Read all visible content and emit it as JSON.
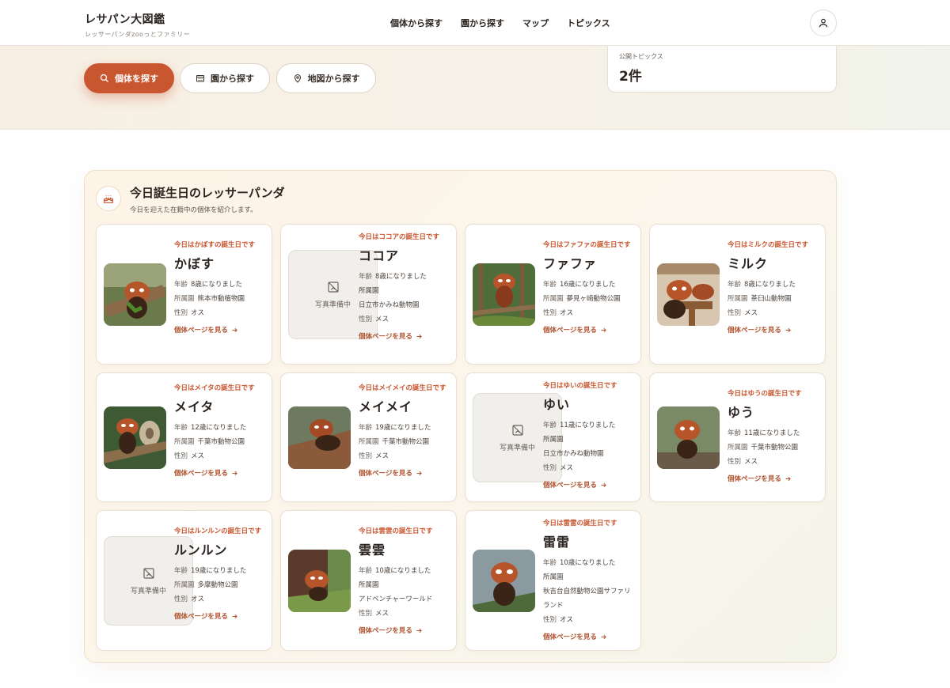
{
  "brand": {
    "title": "レサパン大図鑑",
    "subtitle": "レッサーパンダzooっとファミリー"
  },
  "nav": [
    "個体から探す",
    "園から探す",
    "マップ",
    "トピックス"
  ],
  "hero": {
    "buttons": [
      "個体を探す",
      "園から探す",
      "地図から探す"
    ],
    "stat_label": "公開トピックス",
    "stat_value": "2件"
  },
  "section": {
    "title": "今日誕生日のレッサーパンダ",
    "subtitle": "今日を迎えた在籍中の個体を紹介します。"
  },
  "labels": {
    "age": "年齢",
    "zoo": "所属園",
    "sex": "性別",
    "link": "個体ページを見る",
    "placeholder": "写真準備中"
  },
  "cards": [
    {
      "bday": "今日はかぼすの誕生日です",
      "name": "かぼす",
      "age": "8歳になりました",
      "zoo": "熊本市動植物園",
      "sex": "オス",
      "photo": true
    },
    {
      "bday": "今日はココアの誕生日です",
      "name": "ココア",
      "age": "8歳になりました",
      "zoo": "日立市かみね動物園",
      "sex": "メス",
      "photo": false
    },
    {
      "bday": "今日はファファの誕生日です",
      "name": "ファファ",
      "age": "16歳になりました",
      "zoo": "夢見ヶ崎動物公園",
      "sex": "オス",
      "photo": true
    },
    {
      "bday": "今日はミルクの誕生日です",
      "name": "ミルク",
      "age": "8歳になりました",
      "zoo": "茶臼山動物園",
      "sex": "メス",
      "photo": true
    },
    {
      "bday": "今日はメイタの誕生日です",
      "name": "メイタ",
      "age": "12歳になりました",
      "zoo": "千葉市動物公園",
      "sex": "メス",
      "photo": true
    },
    {
      "bday": "今日はメイメイの誕生日です",
      "name": "メイメイ",
      "age": "19歳になりました",
      "zoo": "千葉市動物公園",
      "sex": "メス",
      "photo": true
    },
    {
      "bday": "今日はゆいの誕生日です",
      "name": "ゆい",
      "age": "11歳になりました",
      "zoo": "日立市かみね動物園",
      "sex": "メス",
      "photo": false
    },
    {
      "bday": "今日はゆうの誕生日です",
      "name": "ゆう",
      "age": "11歳になりました",
      "zoo": "千葉市動物公園",
      "sex": "メス",
      "photo": true
    },
    {
      "bday": "今日はルンルンの誕生日です",
      "name": "ルンルン",
      "age": "19歳になりました",
      "zoo": "多摩動物公園",
      "sex": "オス",
      "photo": false
    },
    {
      "bday": "今日は雲雲の誕生日です",
      "name": "雲雲",
      "age": "10歳になりました",
      "zoo": "アドベンチャーワールド",
      "sex": "メス",
      "photo": true
    },
    {
      "bday": "今日は雷雷の誕生日です",
      "name": "雷雷",
      "age": "10歳になりました",
      "zoo": "秋吉台自然動物公園サファリランド",
      "sex": "オス",
      "photo": true
    }
  ]
}
